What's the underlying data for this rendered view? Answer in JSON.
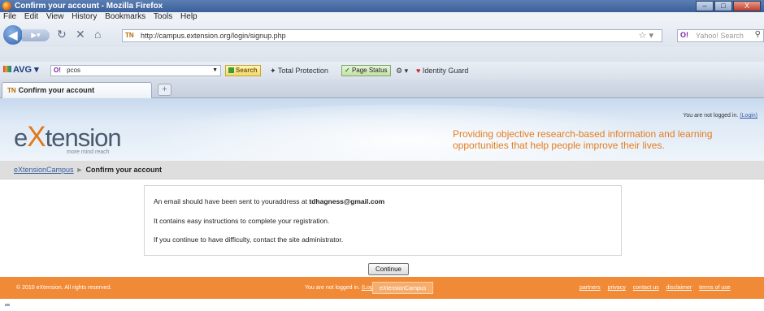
{
  "window": {
    "title": "Confirm your account - Mozilla Firefox",
    "controls": [
      "–",
      "□",
      "X"
    ]
  },
  "menu": [
    "File",
    "Edit",
    "View",
    "History",
    "Bookmarks",
    "Tools",
    "Help"
  ],
  "nav": {
    "url": "http://campus.extension.org/login/signup.php",
    "search_placeholder": "Yahoo! Search",
    "search_engine": "O!"
  },
  "avg": {
    "brand": "AVG",
    "query": "pcos",
    "engine": "O!",
    "search_label": "Search",
    "total_protection": "Total Protection",
    "page_status": "Page Status",
    "identity_guard": "Identity Guard"
  },
  "tab": {
    "title": "Confirm your account",
    "new_tab": "+"
  },
  "site": {
    "login_status_prefix": "You are not logged in.",
    "login_link": "(Login)",
    "logo_prefix": "e",
    "logo_x": "X",
    "logo_suffix": "tension",
    "logo_tagline": "more mind reach",
    "tagline": "Providing objective research-based information and learning opportunities that help people improve their lives."
  },
  "breadcrumb": {
    "home": "eXtensionCampus",
    "separator": "►",
    "current": "Confirm your account"
  },
  "message": {
    "line1_prefix": "An email should have been sent to youraddress at",
    "email": "tdhagness@gmail.com",
    "line2": "It contains easy instructions to complete your registration.",
    "line3": "If you continue to have difficulty, contact the site administrator."
  },
  "continue_label": "Continue",
  "footer": {
    "copyright": "© 2010 eXtension. All rights reserved.",
    "not_logged": "You are not logged in.",
    "login": "(Login)",
    "campus": "eXtensionCampus",
    "links": [
      "partners",
      "privacy",
      "contact us",
      "disclaimer",
      "terms of use"
    ]
  },
  "colors": {
    "accent_orange": "#f18a36",
    "link_blue": "#3a5fa0",
    "tagline_orange": "#e47d1f"
  }
}
